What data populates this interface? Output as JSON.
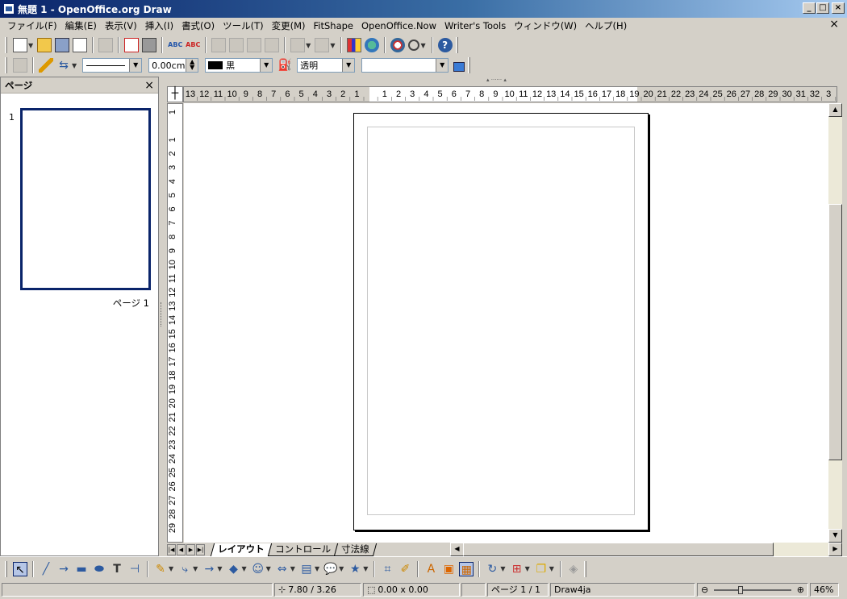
{
  "window": {
    "title": "無題 1 - OpenOffice.org Draw",
    "minimize": "_",
    "maximize": "□",
    "close": "×",
    "doc_close": "×"
  },
  "menu": [
    "ファイル(F)",
    "編集(E)",
    "表示(V)",
    "挿入(I)",
    "書式(O)",
    "ツール(T)",
    "変更(M)",
    "FitShape",
    "OpenOffice.Now",
    "Writer's Tools",
    "ウィンドウ(W)",
    "ヘルプ(H)"
  ],
  "line_props": {
    "width": "0.00cm",
    "line_color": "黒",
    "fill": "透明",
    "fill_color": ""
  },
  "pages_panel": {
    "title": "ページ",
    "close": "×",
    "page_number": "1",
    "thumbnail_label": "ページ 1"
  },
  "ruler": {
    "horizontal": [
      "13",
      "12",
      "11",
      "10",
      "9",
      "8",
      "7",
      "6",
      "5",
      "4",
      "3",
      "2",
      "1",
      "",
      "1",
      "2",
      "3",
      "4",
      "5",
      "6",
      "7",
      "8",
      "9",
      "10",
      "11",
      "12",
      "13",
      "14",
      "15",
      "16",
      "17",
      "18",
      "19",
      "20",
      "21",
      "22",
      "23",
      "24",
      "25",
      "26",
      "27",
      "28",
      "29",
      "30",
      "31",
      "32",
      "3"
    ],
    "vertical": [
      "1",
      "",
      "1",
      "2",
      "3",
      "4",
      "5",
      "6",
      "7",
      "8",
      "9",
      "10",
      "11",
      "12",
      "13",
      "14",
      "15",
      "16",
      "17",
      "18",
      "19",
      "20",
      "21",
      "22",
      "23",
      "24",
      "25",
      "26",
      "27",
      "28",
      "29"
    ]
  },
  "tabs": [
    "レイアウト",
    "コントロール",
    "寸法線"
  ],
  "status": {
    "position": "7.80 / 3.26",
    "size": "0.00 x 0.00",
    "page": "ページ 1 / 1",
    "style": "Draw4ja",
    "zoom": "46%",
    "zoom_minus": "⊖",
    "zoom_plus": "⊕"
  },
  "icons": {
    "standard": [
      "new-icon",
      "open-icon",
      "save-icon",
      "mail-icon",
      "edit-icon",
      "pdf-icon",
      "print-icon",
      "spellcheck-icon",
      "autospell-icon",
      "cut-icon",
      "copy-icon",
      "paste-icon",
      "format-paintbrush-icon",
      "undo-icon",
      "redo-icon",
      "chart-icon",
      "gallery-icon",
      "navigator-icon",
      "zoom-icon",
      "help-icon"
    ],
    "drawing": [
      "select-icon",
      "line-icon",
      "arrow-line-icon",
      "rectangle-icon",
      "ellipse-icon",
      "text-icon",
      "vertical-text-icon",
      "curve-icon",
      "connector-icon",
      "lines-arrows-icon",
      "basic-shapes-icon",
      "symbol-shapes-icon",
      "block-arrows-icon",
      "flowchart-icon",
      "callouts-icon",
      "stars-icon",
      "points-icon",
      "glue-points-icon",
      "fontwork-icon",
      "from-file-icon",
      "gallery-toggle-icon",
      "rotate-icon",
      "alignment-icon",
      "arrange-icon",
      "extrusion-icon"
    ]
  }
}
